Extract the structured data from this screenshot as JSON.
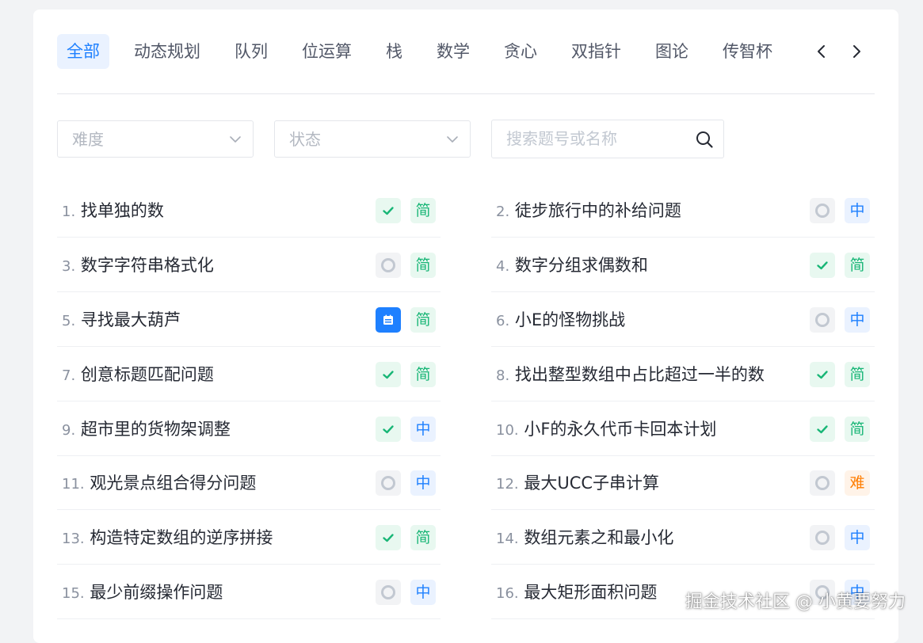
{
  "tabs": {
    "items": [
      "全部",
      "动态规划",
      "队列",
      "位运算",
      "栈",
      "数学",
      "贪心",
      "双指针",
      "图论",
      "传智杯"
    ],
    "active_index": 0
  },
  "filters": {
    "difficulty_placeholder": "难度",
    "status_placeholder": "状态",
    "search_placeholder": "搜索题号或名称"
  },
  "colors": {
    "accent": "#1e80ff",
    "easy": "#18b676",
    "medium": "#1e80ff",
    "hard": "#ff7d00"
  },
  "problems": [
    {
      "num": "1.",
      "title": "找单独的数",
      "status": "done",
      "difficulty": "简"
    },
    {
      "num": "2.",
      "title": "徒步旅行中的补给问题",
      "status": "todo",
      "difficulty": "中"
    },
    {
      "num": "3.",
      "title": "数字字符串格式化",
      "status": "todo",
      "difficulty": "简"
    },
    {
      "num": "4.",
      "title": "数字分组求偶数和",
      "status": "done",
      "difficulty": "简"
    },
    {
      "num": "5.",
      "title": "寻找最大葫芦",
      "status": "calendar",
      "difficulty": "简"
    },
    {
      "num": "6.",
      "title": "小E的怪物挑战",
      "status": "todo",
      "difficulty": "中"
    },
    {
      "num": "7.",
      "title": "创意标题匹配问题",
      "status": "done",
      "difficulty": "简"
    },
    {
      "num": "8.",
      "title": "找出整型数组中占比超过一半的数",
      "status": "done",
      "difficulty": "简"
    },
    {
      "num": "9.",
      "title": "超市里的货物架调整",
      "status": "done",
      "difficulty": "中"
    },
    {
      "num": "10.",
      "title": "小F的永久代币卡回本计划",
      "status": "done",
      "difficulty": "简"
    },
    {
      "num": "11.",
      "title": "观光景点组合得分问题",
      "status": "todo",
      "difficulty": "中"
    },
    {
      "num": "12.",
      "title": "最大UCC子串计算",
      "status": "todo",
      "difficulty": "难"
    },
    {
      "num": "13.",
      "title": "构造特定数组的逆序拼接",
      "status": "done",
      "difficulty": "简"
    },
    {
      "num": "14.",
      "title": "数组元素之和最小化",
      "status": "todo",
      "difficulty": "中"
    },
    {
      "num": "15.",
      "title": "最少前缀操作问题",
      "status": "todo",
      "difficulty": "中"
    },
    {
      "num": "16.",
      "title": "最大矩形面积问题",
      "status": "todo",
      "difficulty": "中"
    }
  ],
  "watermark": "掘金技术社区 @ 小黄要努力"
}
